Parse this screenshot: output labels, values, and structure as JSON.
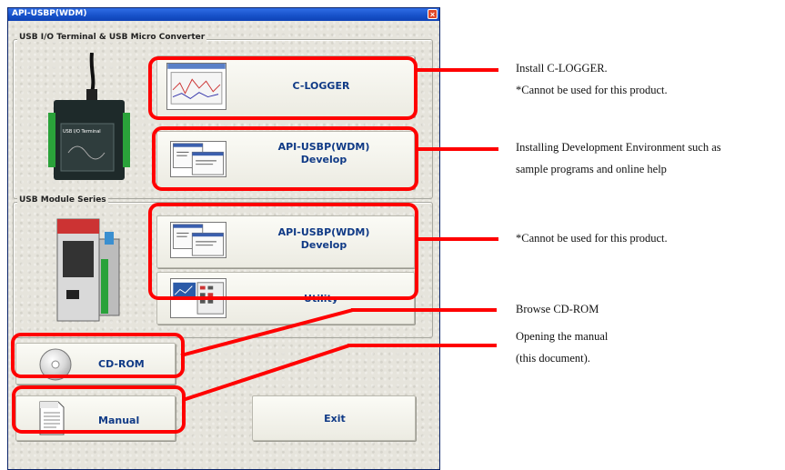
{
  "window": {
    "title": "API-USBP(WDM)",
    "close_glyph": "×"
  },
  "groups": {
    "usb_terminal": "USB I/O Terminal & USB Micro Converter",
    "usb_module": "USB Module Series"
  },
  "buttons": {
    "clogger": "C-LOGGER",
    "develop1_line1": "API-USBP(WDM)",
    "develop1_line2": "Develop",
    "develop2_line1": "API-USBP(WDM)",
    "develop2_line2": "Develop",
    "utility": "Utility",
    "cdrom": "CD-ROM",
    "manual": "Manual",
    "exit": "Exit"
  },
  "device_image": {
    "label": "USB I/O Terminal"
  },
  "annotations": {
    "clogger_line1": "Install C-LOGGER.",
    "clogger_line2": "*Cannot be used for this product.",
    "develop_line1": "Installing Development Environment such as",
    "develop_line2": "sample programs and online help",
    "module": "*Cannot be used for this product.",
    "cdrom": "Browse CD-ROM",
    "manual_line1": "Opening the manual",
    "manual_line2": "(this document)."
  },
  "colors": {
    "highlight": "#ff0000",
    "button_text": "#103a86",
    "titlebar": "#1650c8"
  }
}
